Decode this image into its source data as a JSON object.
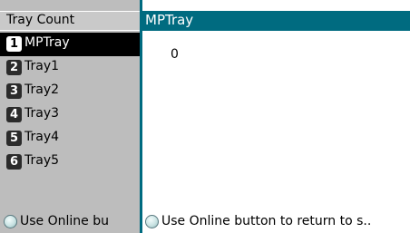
{
  "sidebar": {
    "header": "Tray Count",
    "items": [
      {
        "number": "1",
        "label": "MPTray",
        "selected": true
      },
      {
        "number": "2",
        "label": "Tray1",
        "selected": false
      },
      {
        "number": "3",
        "label": "Tray2",
        "selected": false
      },
      {
        "number": "4",
        "label": "Tray3",
        "selected": false
      },
      {
        "number": "5",
        "label": "Tray4",
        "selected": false
      },
      {
        "number": "6",
        "label": "Tray5",
        "selected": false
      }
    ],
    "footer_text": "Use Online bu",
    "footer_icon": "circle-icon"
  },
  "main": {
    "title": "MPTray",
    "value": "0",
    "footer_text": "Use Online button to return to s..",
    "footer_icon": "circle-icon"
  },
  "colors": {
    "accent": "#006b80",
    "selected_bg": "#000000",
    "sidebar_bg": "#c8c8c8"
  }
}
